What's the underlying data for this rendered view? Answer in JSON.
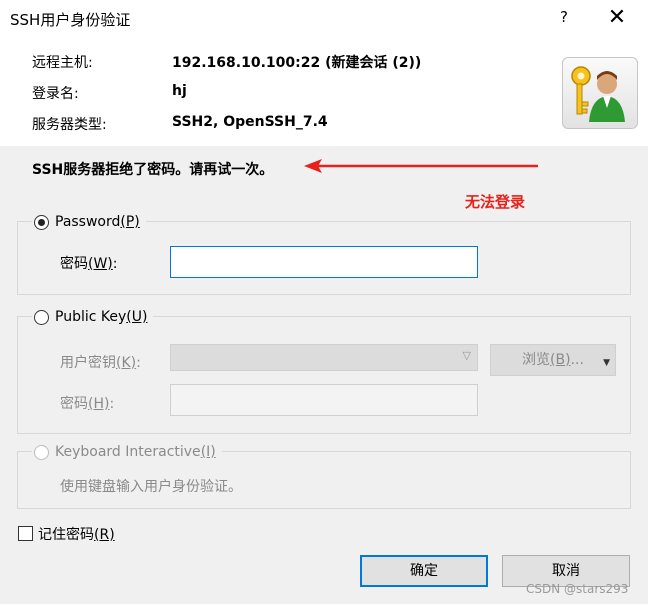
{
  "window": {
    "title": "SSH用户身份验证",
    "help": "?",
    "close": "✕"
  },
  "info": {
    "host_label": "远程主机:",
    "host_value": "192.168.10.100:22 (新建会话 (2))",
    "login_label": "登录名:",
    "login_value": "hj",
    "server_type_label": "服务器类型:",
    "server_type_value": "SSH2, OpenSSH_7.4"
  },
  "error_message": "SSH服务器拒绝了密码。请再试一次。",
  "annotation": {
    "text": "无法登录",
    "color": "#e8211b"
  },
  "password_group": {
    "label": "Password",
    "mnemonic": "(P)",
    "field_label": "密码",
    "field_mnemonic": "(W)",
    "field_suffix": ":",
    "value": ""
  },
  "publickey_group": {
    "label": "Public Key",
    "mnemonic": "(U)",
    "user_key_label": "用户密钥",
    "user_key_mnemonic": "(K)",
    "user_key_suffix": ":",
    "browse_label": "浏览",
    "browse_mnemonic": "(B)",
    "browse_suffix": "...",
    "password_label": "密码",
    "password_mnemonic": "(H)",
    "password_suffix": ":"
  },
  "keyboard_group": {
    "label": "Keyboard Interactive",
    "mnemonic": "(I)",
    "description": "使用键盘输入用户身份验证。"
  },
  "remember": {
    "label": "记住密码",
    "mnemonic": "(R)",
    "checked": false
  },
  "buttons": {
    "ok": "确定",
    "cancel": "取消"
  },
  "watermark": "CSDN @stars293",
  "colors": {
    "accent": "#0078d7",
    "annotation": "#e8211b",
    "dialog_bg": "#f0f0f0"
  }
}
